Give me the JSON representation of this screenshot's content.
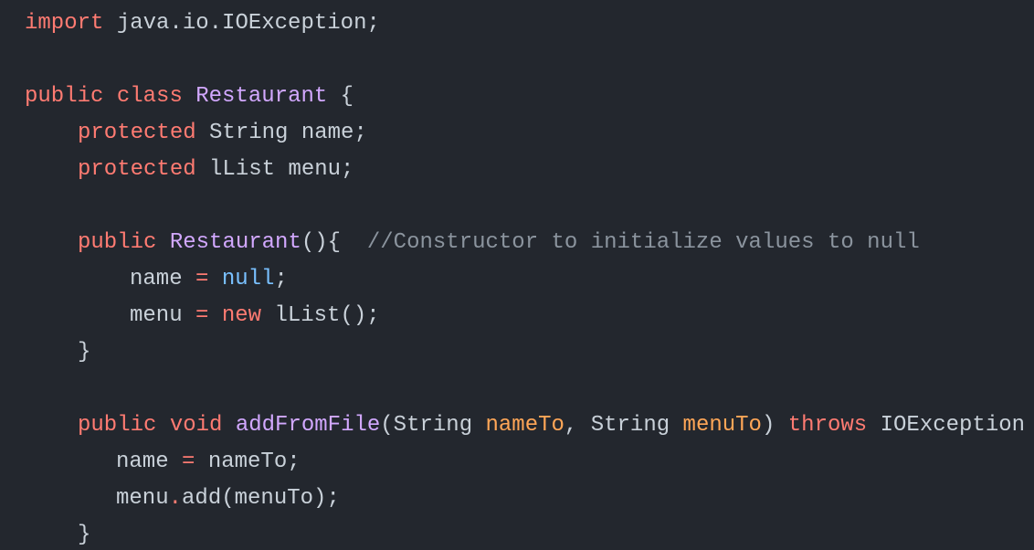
{
  "editor": {
    "background": "#23272e",
    "language": "java",
    "theme_colors": {
      "keyword": "#ff7b72",
      "type": "#d2a8ff",
      "literal": "#79c0ff",
      "parameter": "#ffa657",
      "comment": "#8b949e",
      "text": "#c9d1d9"
    },
    "lines": [
      {
        "id": "line-1",
        "tokens": [
          {
            "t": "import",
            "c": "kw"
          },
          {
            "t": " java.io.IOException;",
            "c": "plain"
          }
        ]
      },
      {
        "id": "line-3",
        "tokens": [
          {
            "t": "public",
            "c": "kw"
          },
          {
            "t": " ",
            "c": "plain"
          },
          {
            "t": "class",
            "c": "kw"
          },
          {
            "t": " ",
            "c": "plain"
          },
          {
            "t": "Restaurant",
            "c": "tp"
          },
          {
            "t": " {",
            "c": "plain"
          }
        ]
      },
      {
        "id": "line-4",
        "tokens": [
          {
            "t": "protected",
            "c": "kw"
          },
          {
            "t": " String name;",
            "c": "plain"
          }
        ]
      },
      {
        "id": "line-5",
        "tokens": [
          {
            "t": "protected",
            "c": "kw"
          },
          {
            "t": " lList menu;",
            "c": "plain"
          }
        ]
      },
      {
        "id": "line-7",
        "tokens": [
          {
            "t": "public",
            "c": "kw"
          },
          {
            "t": " ",
            "c": "plain"
          },
          {
            "t": "Restaurant",
            "c": "fn"
          },
          {
            "t": "(){  ",
            "c": "plain"
          },
          {
            "t": "//Constructor to initialize values to null",
            "c": "cm"
          }
        ]
      },
      {
        "id": "line-8",
        "tokens": [
          {
            "t": "name ",
            "c": "plain"
          },
          {
            "t": "=",
            "c": "op"
          },
          {
            "t": " ",
            "c": "plain"
          },
          {
            "t": "null",
            "c": "lit"
          },
          {
            "t": ";",
            "c": "plain"
          }
        ]
      },
      {
        "id": "line-9",
        "tokens": [
          {
            "t": "menu ",
            "c": "plain"
          },
          {
            "t": "=",
            "c": "op"
          },
          {
            "t": " ",
            "c": "plain"
          },
          {
            "t": "new",
            "c": "kw"
          },
          {
            "t": " lList();",
            "c": "plain"
          }
        ]
      },
      {
        "id": "line-10",
        "tokens": [
          {
            "t": "}",
            "c": "plain"
          }
        ]
      },
      {
        "id": "line-12",
        "tokens": [
          {
            "t": "public",
            "c": "kw"
          },
          {
            "t": " ",
            "c": "plain"
          },
          {
            "t": "void",
            "c": "kw"
          },
          {
            "t": " ",
            "c": "plain"
          },
          {
            "t": "addFromFile",
            "c": "fn"
          },
          {
            "t": "(String ",
            "c": "plain"
          },
          {
            "t": "nameTo",
            "c": "param"
          },
          {
            "t": ", String ",
            "c": "plain"
          },
          {
            "t": "menuTo",
            "c": "param"
          },
          {
            "t": ") ",
            "c": "plain"
          },
          {
            "t": "throws",
            "c": "kw"
          },
          {
            "t": " IOException",
            "c": "plain"
          }
        ]
      },
      {
        "id": "line-13",
        "tokens": [
          {
            "t": "name ",
            "c": "plain"
          },
          {
            "t": "=",
            "c": "op"
          },
          {
            "t": " nameTo;",
            "c": "plain"
          }
        ]
      },
      {
        "id": "line-14",
        "tokens": [
          {
            "t": "menu",
            "c": "plain"
          },
          {
            "t": ".",
            "c": "op"
          },
          {
            "t": "add(menuTo);",
            "c": "plain"
          }
        ]
      },
      {
        "id": "line-15",
        "tokens": [
          {
            "t": "}",
            "c": "plain"
          }
        ]
      }
    ]
  }
}
